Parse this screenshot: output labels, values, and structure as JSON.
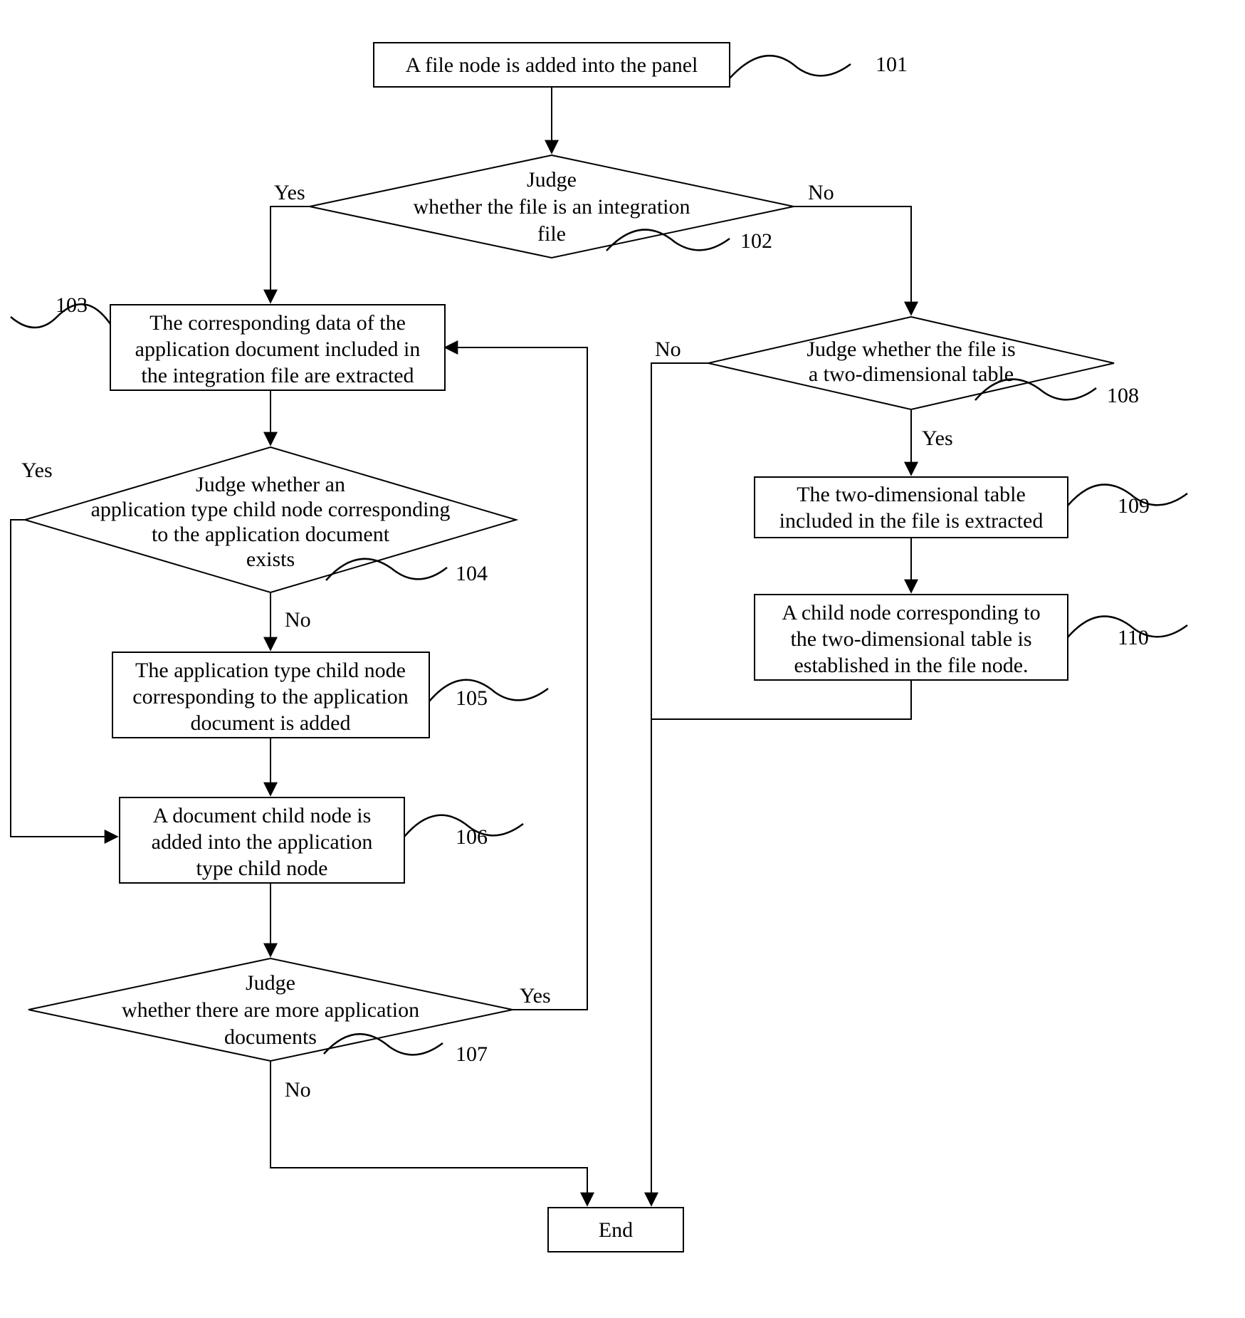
{
  "nodes": {
    "n101": {
      "ref": "101",
      "lines": [
        "A file node is added into the panel"
      ]
    },
    "n102": {
      "ref": "102",
      "lines": [
        "Judge",
        "whether the file is an integration",
        "file"
      ]
    },
    "n103": {
      "ref": "103",
      "lines": [
        "The corresponding data of the",
        "application document included in",
        "the integration file are extracted"
      ]
    },
    "n104": {
      "ref": "104",
      "lines": [
        "Judge whether an",
        "application type child node corresponding",
        "to the application document",
        "exists"
      ]
    },
    "n105": {
      "ref": "105",
      "lines": [
        "The application type child node",
        "corresponding to the application",
        "document is added"
      ]
    },
    "n106": {
      "ref": "106",
      "lines": [
        "A document child node is",
        "added into the application",
        "type child node"
      ]
    },
    "n107": {
      "ref": "107",
      "lines": [
        "Judge",
        "whether there are more application",
        "documents"
      ]
    },
    "n108": {
      "ref": "108",
      "lines": [
        "Judge whether the file is",
        "a two-dimensional table"
      ]
    },
    "n109": {
      "ref": "109",
      "lines": [
        "The two-dimensional table",
        "included in the file is extracted"
      ]
    },
    "n110": {
      "ref": "110",
      "lines": [
        "A child node corresponding to",
        "the two-dimensional table is",
        "established in the file node."
      ]
    },
    "end": {
      "lines": [
        "End"
      ]
    }
  },
  "branch_labels": {
    "n102_yes": "Yes",
    "n102_no": "No",
    "n104_yes": "Yes",
    "n104_no": "No",
    "n107_yes": "Yes",
    "n107_no": "No",
    "n108_yes": "Yes",
    "n108_no": "No"
  }
}
